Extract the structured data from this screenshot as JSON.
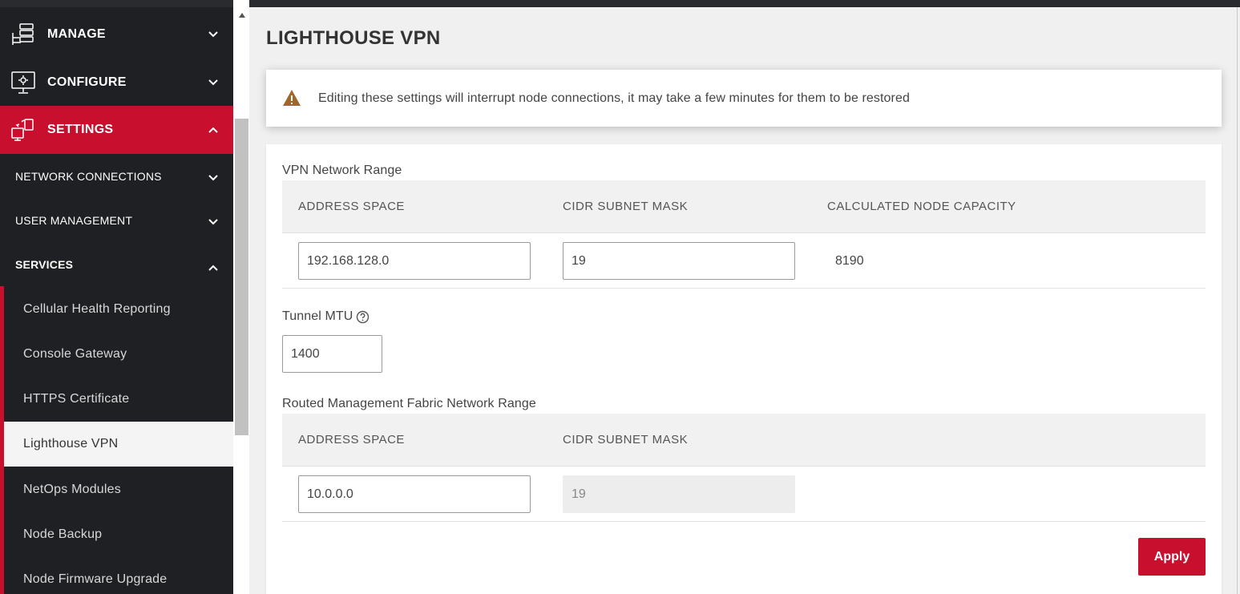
{
  "sidebar": {
    "manage_label": "MANAGE",
    "configure_label": "CONFIGURE",
    "settings_label": "SETTINGS",
    "network_connections_label": "NETWORK CONNECTIONS",
    "user_management_label": "USER MANAGEMENT",
    "services_label": "SERVICES",
    "services_items": [
      {
        "label": "Cellular Health Reporting"
      },
      {
        "label": "Console Gateway"
      },
      {
        "label": "HTTPS Certificate"
      },
      {
        "label": "Lighthouse VPN"
      },
      {
        "label": "NetOps Modules"
      },
      {
        "label": "Node Backup"
      },
      {
        "label": "Node Firmware Upgrade"
      }
    ],
    "active_section": "SETTINGS",
    "selected_item": "Lighthouse VPN"
  },
  "page": {
    "title": "LIGHTHOUSE VPN",
    "warning_text": "Editing these settings will interrupt node connections, it may take a few minutes for them to be restored"
  },
  "vpn_range": {
    "title": "VPN Network Range",
    "col_address": "ADDRESS SPACE",
    "col_cidr": "CIDR SUBNET MASK",
    "col_capacity": "CALCULATED NODE CAPACITY",
    "address_value": "192.168.128.0",
    "cidr_value": "19",
    "capacity_value": "8190"
  },
  "tunnel_mtu": {
    "label": "Tunnel MTU",
    "value": "1400"
  },
  "fabric_range": {
    "title": "Routed Management Fabric Network Range",
    "col_address": "ADDRESS SPACE",
    "col_cidr": "CIDR SUBNET MASK",
    "address_value": "10.0.0.0",
    "cidr_value": "19"
  },
  "actions": {
    "apply_label": "Apply"
  },
  "colors": {
    "accent": "#c8102e",
    "sidebar_bg": "#1f2023",
    "warning_icon": "#a0662a"
  }
}
